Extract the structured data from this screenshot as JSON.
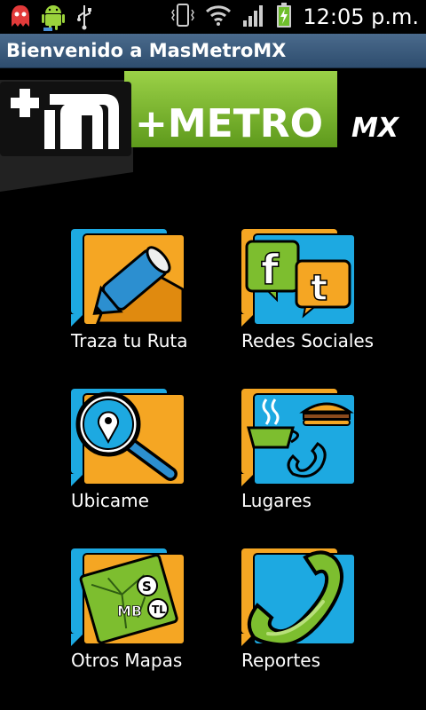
{
  "status_bar": {
    "time": "12:05 p.m.",
    "icons": [
      "notification-ghost-icon",
      "android-icon",
      "usb-icon",
      "vibrate-icon",
      "wifi-icon",
      "signal-icon",
      "battery-charging-icon"
    ]
  },
  "title_bar": {
    "title": "Bienvenido a MasMetroMX"
  },
  "banner": {
    "wordmark": "+METRO",
    "suffix": "MX"
  },
  "menu": {
    "items": [
      {
        "label": "Traza tu Ruta",
        "icon": "pencil-map-icon"
      },
      {
        "label": "Redes Sociales",
        "icon": "facebook-twitter-icon"
      },
      {
        "label": "Ubicame",
        "icon": "magnifier-location-icon"
      },
      {
        "label": "Lugares",
        "icon": "coffee-burger-phone-icon"
      },
      {
        "label": "Otros Mapas",
        "icon": "transit-map-icon"
      },
      {
        "label": "Reportes",
        "icon": "phone-icon"
      }
    ]
  },
  "colors": {
    "orange": "#f5a623",
    "cyan": "#1da9e1",
    "green": "#7dbe2f",
    "title_bar": "#3b5b7d"
  }
}
